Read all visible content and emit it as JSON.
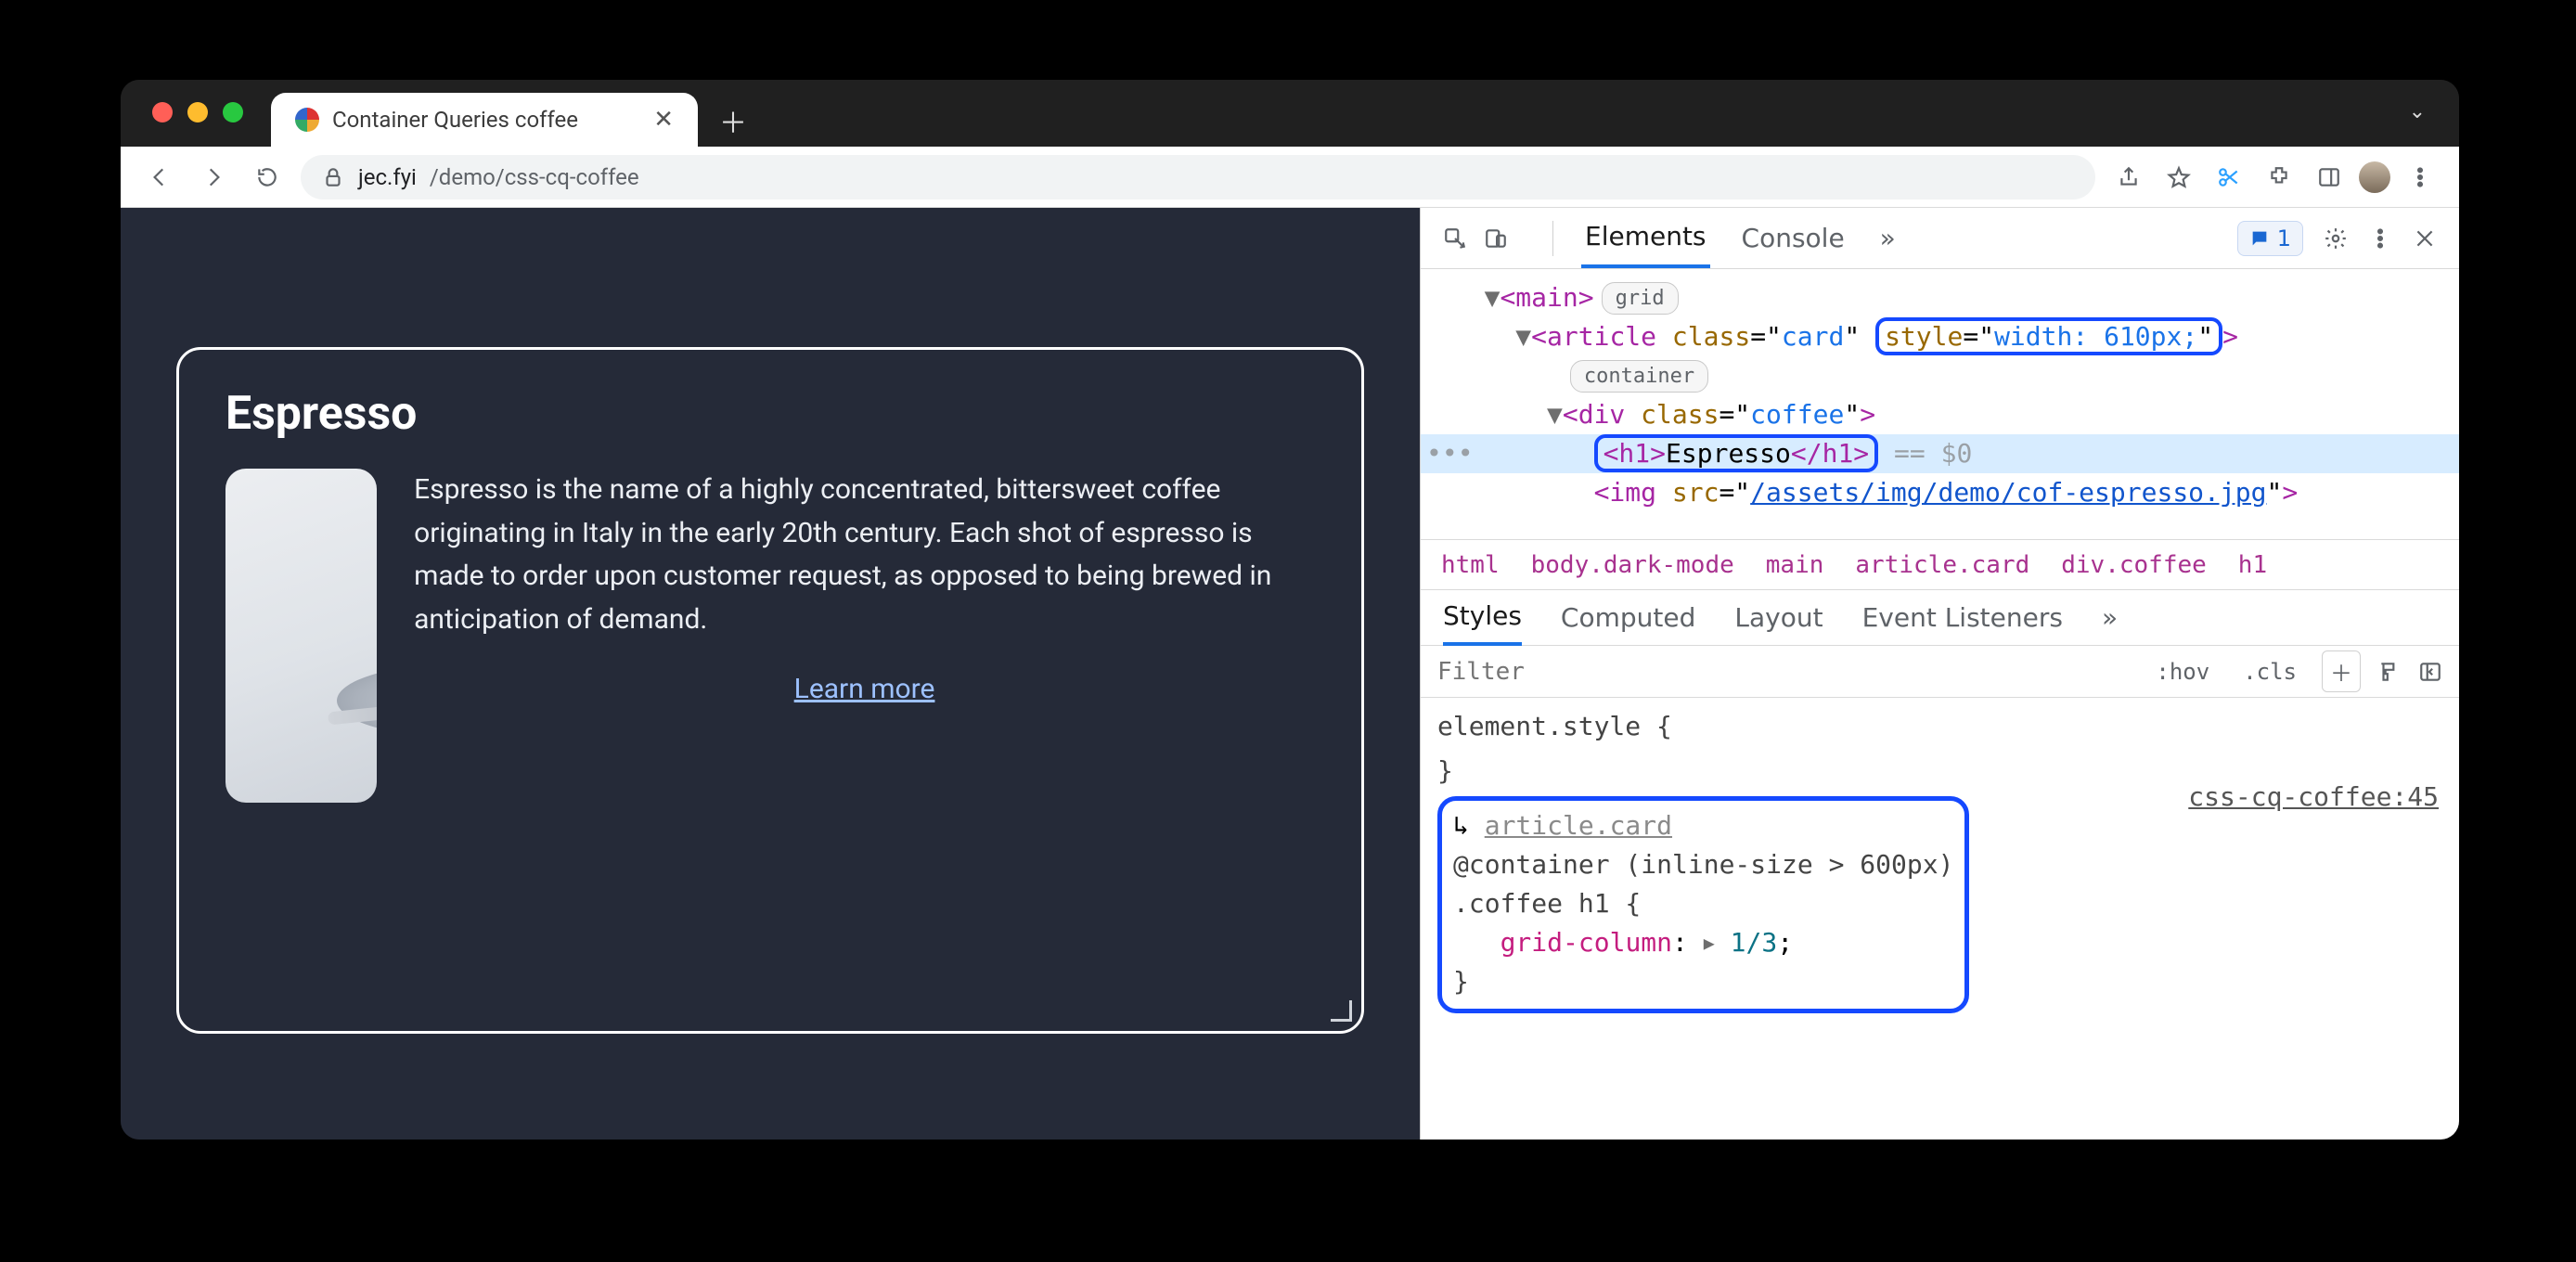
{
  "window": {
    "tab_title": "Container Queries coffee",
    "url_host": "jec.fyi",
    "url_path": "/demo/css-cq-coffee"
  },
  "page": {
    "card_title": "Espresso",
    "card_desc": "Espresso is the name of a highly concentrated, bittersweet coffee originating in Italy in the early 20th century. Each shot of espresso is made to order upon customer request, as opposed to being brewed in anticipation of demand.",
    "learn_more": "Learn more"
  },
  "devtools": {
    "tabs": {
      "elements": "Elements",
      "console": "Console"
    },
    "issues_count": "1",
    "dom": {
      "main_tag": "main",
      "main_badge": "grid",
      "article_open": "article",
      "article_class_attr": "class",
      "article_class_val": "card",
      "article_style_attr": "style",
      "article_style_val": "width: 610px;",
      "article_badge": "container",
      "div_class_attr": "class",
      "div_class_val": "coffee",
      "h1_text": "Espresso",
      "sel_suffix": "== $0",
      "img_src_attr": "src",
      "img_src_val": "/assets/img/demo/cof-espresso.jpg"
    },
    "breadcrumb": [
      "html",
      "body.dark-mode",
      "main",
      "article.card",
      "div.coffee",
      "h1"
    ],
    "subtabs": {
      "styles": "Styles",
      "computed": "Computed",
      "layout": "Layout",
      "event": "Event Listeners"
    },
    "filter": {
      "placeholder": "Filter",
      "hov": ":hov",
      "cls": ".cls"
    },
    "styles": {
      "element_style": "element.style {",
      "element_style_close": "}",
      "inherit_link": "article.card",
      "container_line": "@container (inline-size > 600px)",
      "selector_line": ".coffee h1 {",
      "prop_name": "grid-column",
      "prop_value": "1/3",
      "close": "}",
      "origin": "css-cq-coffee:45"
    }
  }
}
